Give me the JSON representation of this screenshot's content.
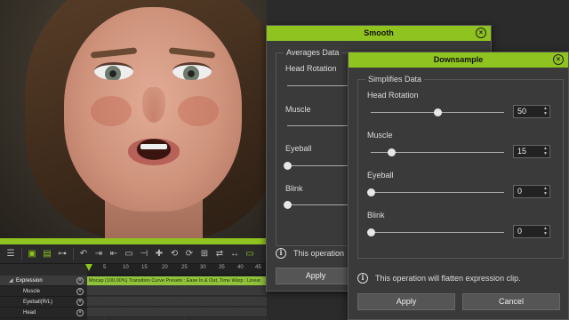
{
  "smooth_dialog": {
    "title": "Smooth",
    "group_title": "Averages Data",
    "sliders": [
      {
        "label": "Head Rotation",
        "level": 0.6
      },
      {
        "label": "Muscle",
        "level": 0.35
      },
      {
        "label": "Eyeball",
        "level": 0.0
      },
      {
        "label": "Blink",
        "level": 0.0
      }
    ],
    "info_text": "This operation",
    "apply_label": "Apply"
  },
  "downsample_dialog": {
    "title": "Downsample",
    "group_title": "Simplifies Data",
    "sliders": [
      {
        "label": "Head Rotation",
        "value": "50",
        "level": 0.5
      },
      {
        "label": "Muscle",
        "value": "15",
        "level": 0.15
      },
      {
        "label": "Eyeball",
        "value": "0",
        "level": 0.0
      },
      {
        "label": "Blink",
        "value": "0",
        "level": 0.0
      }
    ],
    "info_text": "This operation will flatten expression clip.",
    "apply_label": "Apply",
    "cancel_label": "Cancel"
  },
  "timeline": {
    "ruler_ticks": [
      "5",
      "10",
      "15",
      "20",
      "25",
      "30",
      "35",
      "40",
      "45"
    ],
    "tracks": [
      {
        "label": "Expression",
        "selected": true
      },
      {
        "label": "Muscle",
        "selected": false
      },
      {
        "label": "Eyeball(R/L)",
        "selected": false
      },
      {
        "label": "Head",
        "selected": false
      }
    ],
    "clip_label": "Mocap (100.00%) Transition Curve Presets : Ease In & Out, Time Warp : Linear"
  },
  "colors": {
    "accent": "#8fc31f",
    "dialog_bg": "#3a3a3a"
  }
}
